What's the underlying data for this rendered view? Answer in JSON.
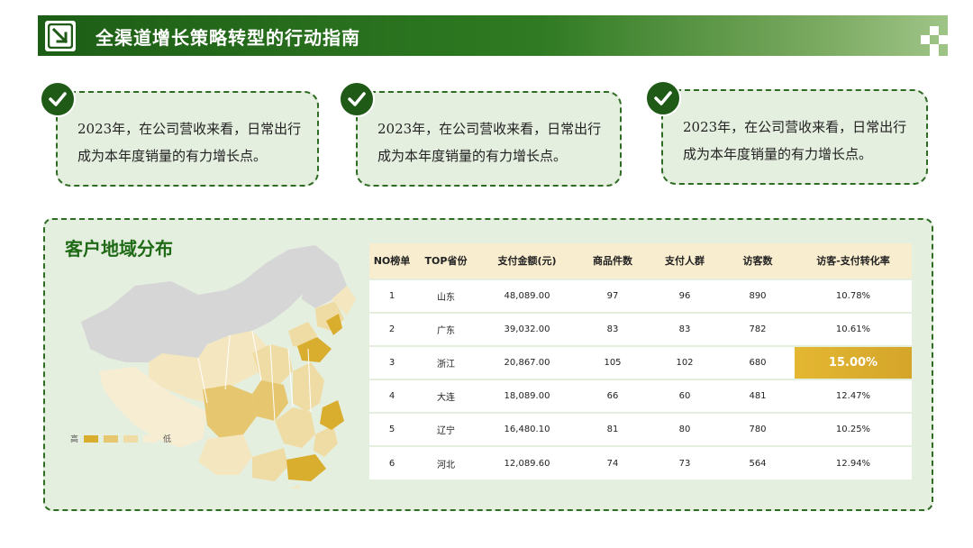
{
  "header": {
    "title": "全渠道增长策略转型的行动指南",
    "logo_icon": "arrow-down-right-icon"
  },
  "cards": [
    {
      "text": "2023年，在公司营收来看，日常出行成为本年度销量的有力增长点。",
      "icon": "check-icon"
    },
    {
      "text": "2023年，在公司营收来看，日常出行成为本年度销量的有力增长点。",
      "icon": "check-icon"
    },
    {
      "text": "2023年，在公司营收来看，日常出行成为本年度销量的有力增长点。",
      "icon": "check-icon"
    }
  ],
  "panel": {
    "title": "客户地域分布",
    "legend": {
      "high": "高",
      "low": "低",
      "colors": [
        "#d9ad2e",
        "#e6c66f",
        "#efdca5",
        "#f7edd2"
      ]
    }
  },
  "table": {
    "headers": [
      "NO榜单",
      "TOP省份",
      "支付金额(元)",
      "商品件数",
      "支付人群",
      "访客数",
      "访客-支付转化率"
    ],
    "rows": [
      [
        "1",
        "山东",
        "48,089.00",
        "97",
        "96",
        "890",
        "10.78%"
      ],
      [
        "2",
        "广东",
        "39,032.00",
        "83",
        "83",
        "782",
        "10.61%"
      ],
      [
        "3",
        "浙江",
        "20,867.00",
        "105",
        "102",
        "680",
        "15.00%"
      ],
      [
        "4",
        "大连",
        "18,089.00",
        "66",
        "60",
        "481",
        "12.47%"
      ],
      [
        "5",
        "辽宁",
        "16,480.10",
        "81",
        "80",
        "780",
        "10.25%"
      ],
      [
        "6",
        "河北",
        "12,089.60",
        "74",
        "73",
        "564",
        "12.94%"
      ]
    ],
    "highlight_color": "#e0b22f"
  },
  "colors": {
    "brand_green": "#1f5a17",
    "card_bg": "#e5efdf",
    "header_bg": "#f9edcf"
  }
}
